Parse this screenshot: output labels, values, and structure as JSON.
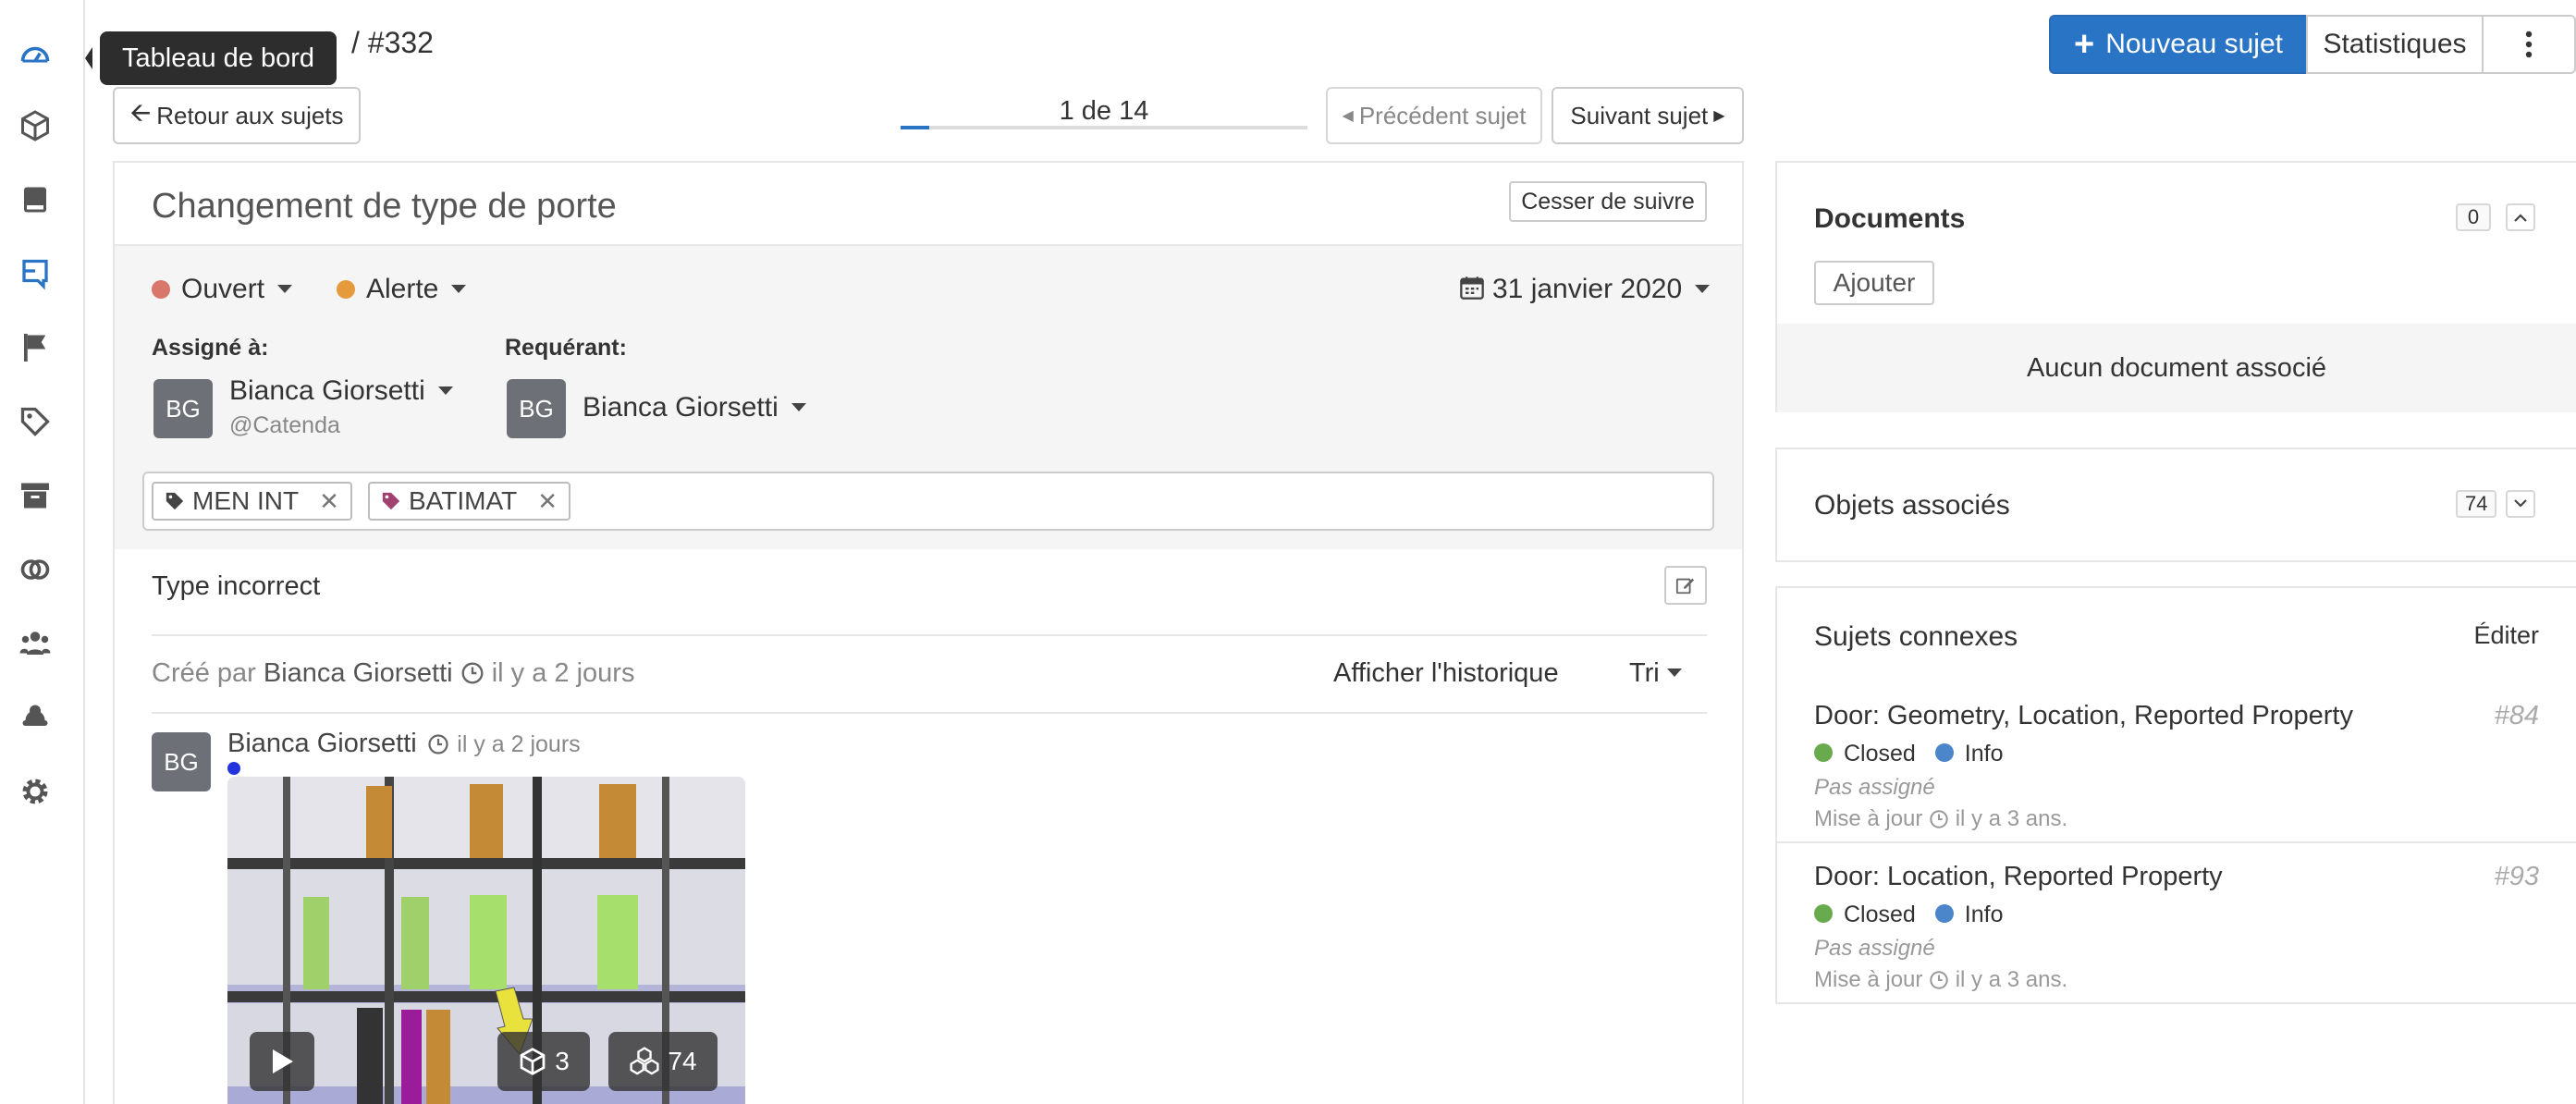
{
  "sidebar": {
    "items": [
      {
        "name": "dashboard-icon"
      },
      {
        "name": "models-cube-icon"
      },
      {
        "name": "documents-book-icon"
      },
      {
        "name": "issues-icon"
      },
      {
        "name": "flag-icon"
      },
      {
        "name": "tag-icon"
      },
      {
        "name": "archive-icon"
      },
      {
        "name": "links-icon"
      },
      {
        "name": "team-icon"
      },
      {
        "name": "user-icon"
      },
      {
        "name": "settings-gear-icon"
      }
    ],
    "tooltip": "Tableau de bord"
  },
  "header": {
    "breadcrumb_id": "/ #332",
    "new_issue_label": "Nouveau sujet",
    "stats_label": "Statistiques",
    "back_label": "Retour aux sujets",
    "progress_label": "1 de 14",
    "progress_fraction": 0.071,
    "prev_label": "Précédent sujet",
    "next_label": "Suivant sujet"
  },
  "issue": {
    "title": "Changement de type de porte",
    "unfollow_label": "Cesser de suivre",
    "status": {
      "label": "Ouvert",
      "color": "#d9776a"
    },
    "priority": {
      "label": "Alerte",
      "color": "#e59a3c"
    },
    "date": "31 janvier 2020",
    "assigned_label": "Assigné à:",
    "assignee": {
      "initials": "BG",
      "name": "Bianca Giorsetti",
      "handle": "@Catenda"
    },
    "requester_label": "Requérant:",
    "requester": {
      "initials": "BG",
      "name": "Bianca Giorsetti"
    },
    "tags": [
      {
        "label": "MEN INT",
        "color": "#444444"
      },
      {
        "label": "BATIMAT",
        "color": "#a0416f"
      }
    ],
    "description": "Type incorrect",
    "created_prefix": "Créé par",
    "created_by": "Bianca Giorsetti",
    "created_ago": "il y a 2 jours",
    "history_label": "Afficher l'historique",
    "sort_label": "Tri"
  },
  "comment": {
    "initials": "BG",
    "author": "Bianca Giorsetti",
    "ago": "il y a 2 jours",
    "objects_count": "3",
    "linked_count": "74"
  },
  "documents": {
    "title": "Documents",
    "count": "0",
    "add_label": "Ajouter",
    "empty_text": "Aucun document associé"
  },
  "linked_objects": {
    "title": "Objets associés",
    "count": "74"
  },
  "related": {
    "title": "Sujets connexes",
    "edit_label": "Éditer",
    "items": [
      {
        "title": "Door: Geometry, Location, Reported Property",
        "number": "#84",
        "status": "Closed",
        "status_color": "#6aaa4e",
        "type": "Info",
        "type_color": "#4a86c9",
        "assignee": "Pas assigné",
        "updated_prefix": "Mise à jour",
        "updated_ago": "il y a 3 ans."
      },
      {
        "title": "Door: Location, Reported Property",
        "number": "#93",
        "status": "Closed",
        "status_color": "#6aaa4e",
        "type": "Info",
        "type_color": "#4a86c9",
        "assignee": "Pas assigné",
        "updated_prefix": "Mise à jour",
        "updated_ago": "il y a 3 ans."
      }
    ]
  },
  "colors": {
    "primary": "#2a74c6",
    "sidebar_active": "#2a74c6",
    "sidebar_icon": "#555555"
  }
}
